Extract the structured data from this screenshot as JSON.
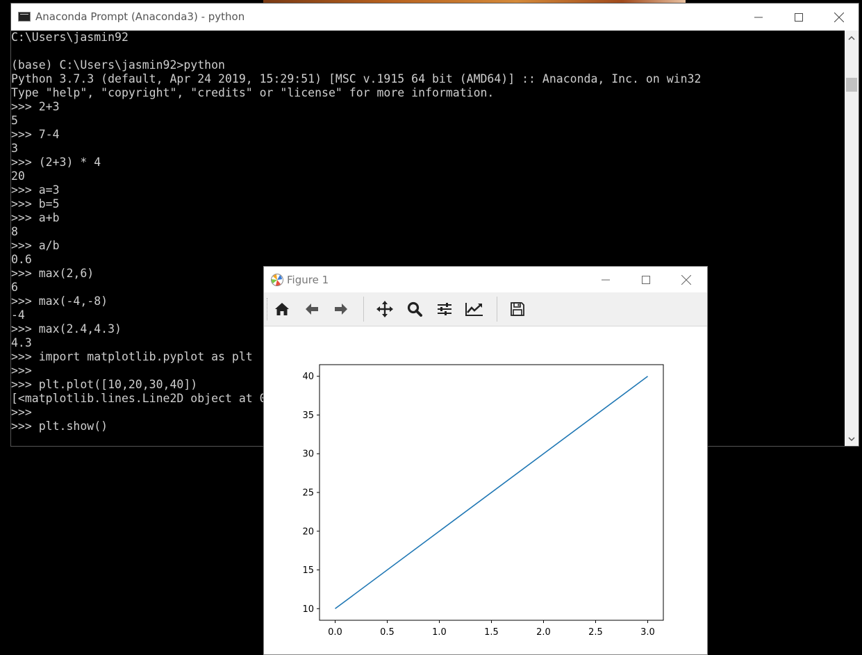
{
  "console": {
    "title": "Anaconda Prompt (Anaconda3) - python",
    "lines": [
      "C:\\Users\\jasmin92",
      "",
      "(base) C:\\Users\\jasmin92>python",
      "Python 3.7.3 (default, Apr 24 2019, 15:29:51) [MSC v.1915 64 bit (AMD64)] :: Anaconda, Inc. on win32",
      "Type \"help\", \"copyright\", \"credits\" or \"license\" for more information.",
      ">>> 2+3",
      "5",
      ">>> 7-4",
      "3",
      ">>> (2+3) * 4",
      "20",
      ">>> a=3",
      ">>> b=5",
      ">>> a+b",
      "8",
      ">>> a/b",
      "0.6",
      ">>> max(2,6)",
      "6",
      ">>> max(-4,-8)",
      "-4",
      ">>> max(2.4,4.3)",
      "4.3",
      ">>> import matplotlib.pyplot as plt",
      ">>>",
      ">>> plt.plot([10,20,30,40])",
      "[<matplotlib.lines.Line2D object at 0",
      ">>>",
      ">>> plt.show()"
    ]
  },
  "figure": {
    "title": "Figure 1",
    "toolbar": [
      {
        "name": "home-icon",
        "tooltip": "Home"
      },
      {
        "name": "arrow-left-icon",
        "tooltip": "Back"
      },
      {
        "name": "arrow-right-icon",
        "tooltip": "Forward"
      },
      {
        "name": "move-icon",
        "tooltip": "Pan"
      },
      {
        "name": "zoom-icon",
        "tooltip": "Zoom"
      },
      {
        "name": "sliders-icon",
        "tooltip": "Subplots"
      },
      {
        "name": "line-chart-icon",
        "tooltip": "Customize"
      },
      {
        "name": "save-icon",
        "tooltip": "Save"
      }
    ]
  },
  "chart_data": {
    "type": "line",
    "x": [
      0,
      1,
      2,
      3
    ],
    "series": [
      {
        "values": [
          10,
          20,
          30,
          40
        ],
        "color": "#1f77b4"
      }
    ],
    "xticks": [
      "0.0",
      "0.5",
      "1.0",
      "1.5",
      "2.0",
      "2.5",
      "3.0"
    ],
    "yticks": [
      "10",
      "15",
      "20",
      "25",
      "30",
      "35",
      "40"
    ],
    "xlim": [
      -0.15,
      3.15
    ],
    "ylim": [
      8.5,
      41.5
    ],
    "title": "",
    "xlabel": "",
    "ylabel": ""
  }
}
